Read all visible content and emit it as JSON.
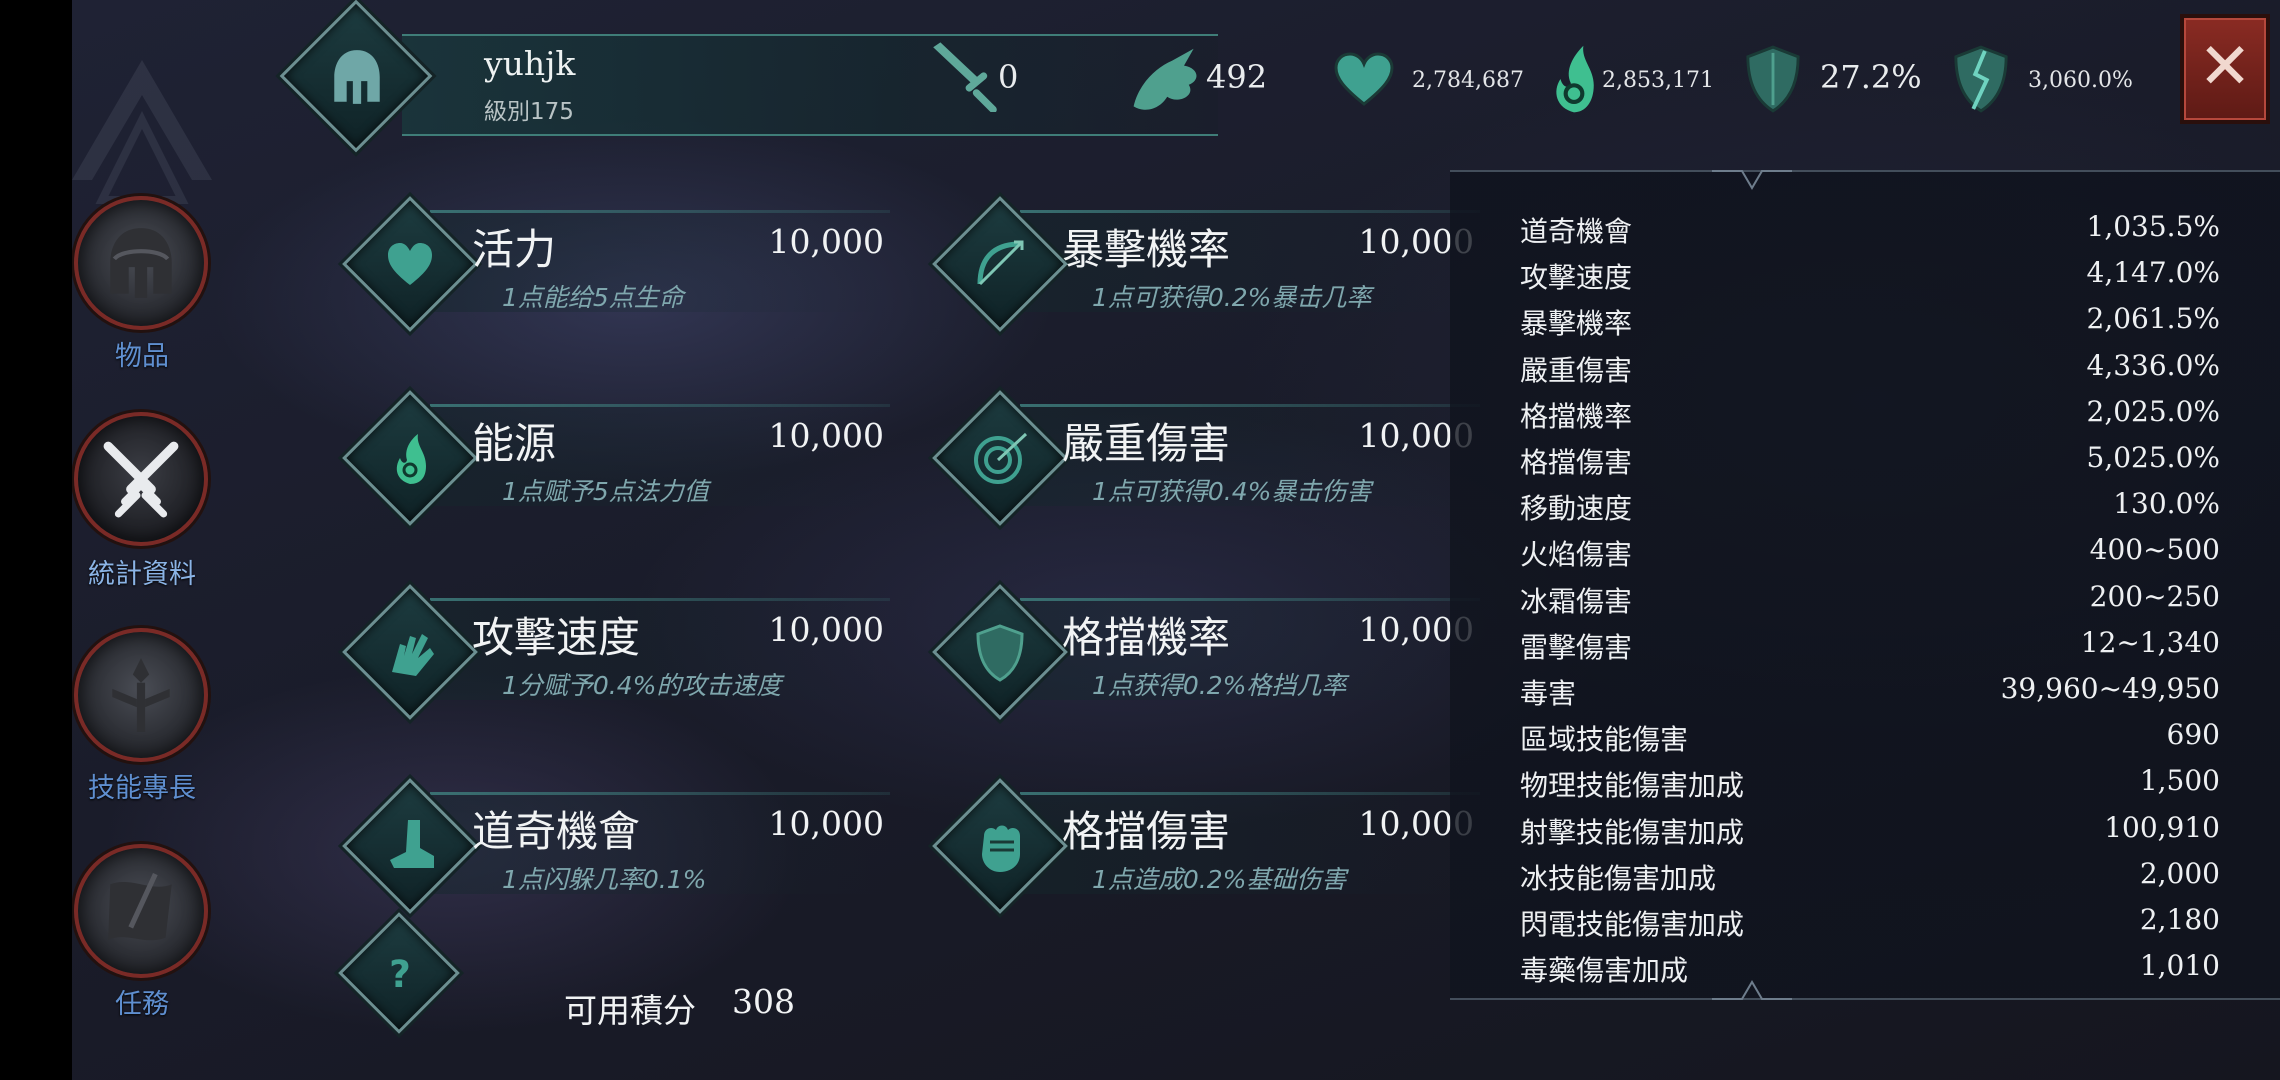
{
  "nav": {
    "items": [
      {
        "label": "物品",
        "icon": "spartan-helmet-icon",
        "active": false
      },
      {
        "label": "統計資料",
        "icon": "crossed-swords-icon",
        "active": true
      },
      {
        "label": "技能專長",
        "icon": "skill-tree-icon",
        "active": false
      },
      {
        "label": "任務",
        "icon": "scroll-quill-icon",
        "active": false
      }
    ]
  },
  "player": {
    "name": "yuhjk",
    "level": "級別175",
    "avatar_icon": "spartan-helmet-icon",
    "sword_icon": "sword-icon",
    "sword_value": "0",
    "splash_icon": "blood-splash-icon",
    "splash_value": "492"
  },
  "summary": {
    "health_icon": "heart-icon",
    "health": "2,784,687",
    "mana_icon": "spirit-flame-icon",
    "mana": "2,853,171",
    "armor_icon": "shield-icon",
    "armor": "27.2%",
    "damage_icon": "broken-shield-icon",
    "damage": "3,060.0%"
  },
  "close_button": {
    "label": "✕"
  },
  "attributes": [
    {
      "name": "活力",
      "value": "10,000",
      "desc": "1点能给5点生命",
      "icon": "heart-icon"
    },
    {
      "name": "暴擊機率",
      "value": "10,000",
      "desc": "1点可获得0.2%暴击几率",
      "icon": "bow-arrow-icon"
    },
    {
      "name": "能源",
      "value": "10,000",
      "desc": "1点赋予5点法力值",
      "icon": "spirit-flame-icon"
    },
    {
      "name": "嚴重傷害",
      "value": "10,000",
      "desc": "1点可获得0.4%暴击伤害",
      "icon": "target-arrow-icon"
    },
    {
      "name": "攻擊速度",
      "value": "10,000",
      "desc": "1分赋予0.4%的攻击速度",
      "icon": "gauntlet-hand-icon"
    },
    {
      "name": "格擋機率",
      "value": "10,000",
      "desc": "1点获得0.2%格挡几率",
      "icon": "shield-icon"
    },
    {
      "name": "道奇機會",
      "value": "10,000",
      "desc": "1点闪躲几率0.1%",
      "icon": "boot-icon"
    },
    {
      "name": "格擋傷害",
      "value": "10,000",
      "desc": "1点造成0.2%基础伤害",
      "icon": "fist-icon"
    }
  ],
  "help": {
    "icon": "question-mark-icon"
  },
  "points": {
    "label": "可用積分",
    "value": "308"
  },
  "stats": [
    {
      "label": "道奇機會",
      "value": "1,035.5%"
    },
    {
      "label": "攻擊速度",
      "value": "4,147.0%"
    },
    {
      "label": "暴擊機率",
      "value": "2,061.5%"
    },
    {
      "label": "嚴重傷害",
      "value": "4,336.0%"
    },
    {
      "label": "格擋機率",
      "value": "2,025.0%"
    },
    {
      "label": "格擋傷害",
      "value": "5,025.0%"
    },
    {
      "label": "移動速度",
      "value": "130.0%"
    },
    {
      "label": "火焰傷害",
      "value": "400~500"
    },
    {
      "label": "冰霜傷害",
      "value": "200~250"
    },
    {
      "label": "雷擊傷害",
      "value": "12~1,340"
    },
    {
      "label": "毒害",
      "value": "39,960~49,950"
    },
    {
      "label": "區域技能傷害",
      "value": "690"
    },
    {
      "label": "物理技能傷害加成",
      "value": "1,500"
    },
    {
      "label": "射擊技能傷害加成",
      "value": "100,910"
    },
    {
      "label": "冰技能傷害加成",
      "value": "2,000"
    },
    {
      "label": "閃電技能傷害加成",
      "value": "2,180"
    },
    {
      "label": "毒藥傷害加成",
      "value": "1,010"
    }
  ],
  "colors": {
    "accent": "#6fd3c0",
    "close": "#8a2b23",
    "nav_label": "#5f8fd0"
  }
}
